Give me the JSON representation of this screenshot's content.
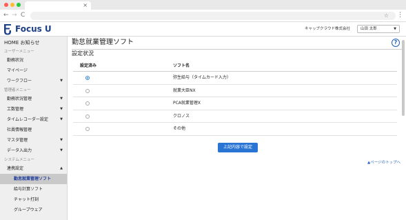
{
  "browser": {
    "close_glyph": "×",
    "back": "←",
    "forward": "→",
    "reload": "C",
    "star": "☆",
    "menu": "⋮"
  },
  "header": {
    "logo_text": "Focus U",
    "company": "キャップクラウド株式会社",
    "user_name": "山田 太郎",
    "user_caret": "▼"
  },
  "sidebar": {
    "home": "HOME お知らせ",
    "user_section": "ユーザーメニュー",
    "user_items": [
      {
        "label": "勤務状況"
      },
      {
        "label": "マイページ"
      },
      {
        "label": "ワークフロー",
        "arrow": "▼"
      }
    ],
    "admin_section": "管理者メニュー",
    "admin_items": [
      {
        "label": "勤務状況管理",
        "arrow": "▼"
      },
      {
        "label": "工数管理",
        "arrow": "▼"
      },
      {
        "label": "タイムレコーダー設定",
        "arrow": "▼"
      },
      {
        "label": "社員情報管理"
      },
      {
        "label": "マスタ管理",
        "arrow": "▼"
      },
      {
        "label": "データ入出力",
        "arrow": "▼"
      }
    ],
    "system_section": "システムメニュー",
    "system_items": [
      {
        "label": "連携設定",
        "arrow": "▲"
      }
    ],
    "sub_items": [
      {
        "label": "勤怠就業管理ソフト"
      },
      {
        "label": "給与計算ソフト"
      },
      {
        "label": "チャット打刻"
      },
      {
        "label": "グループウェア"
      }
    ]
  },
  "main": {
    "title": "勤怠就業管理ソフト",
    "help": "?",
    "section_title": "設定状況",
    "columns": {
      "status": "設定済み",
      "software": "ソフト名"
    },
    "rows": [
      {
        "name": "弥生給与（タイムカード入力）",
        "checked": true
      },
      {
        "name": "就業大臣NX",
        "checked": false
      },
      {
        "name": "PCA就業管理X",
        "checked": false
      },
      {
        "name": "クロノス",
        "checked": false
      },
      {
        "name": "その他",
        "checked": false
      }
    ],
    "submit_label": "上記内容で設定",
    "page_top": "▲ページのトップへ"
  },
  "colors": {
    "brand": "#1d3f88",
    "accent": "#2a75d4",
    "link": "#2a65c0",
    "sidebar_bg": "#efefef"
  }
}
